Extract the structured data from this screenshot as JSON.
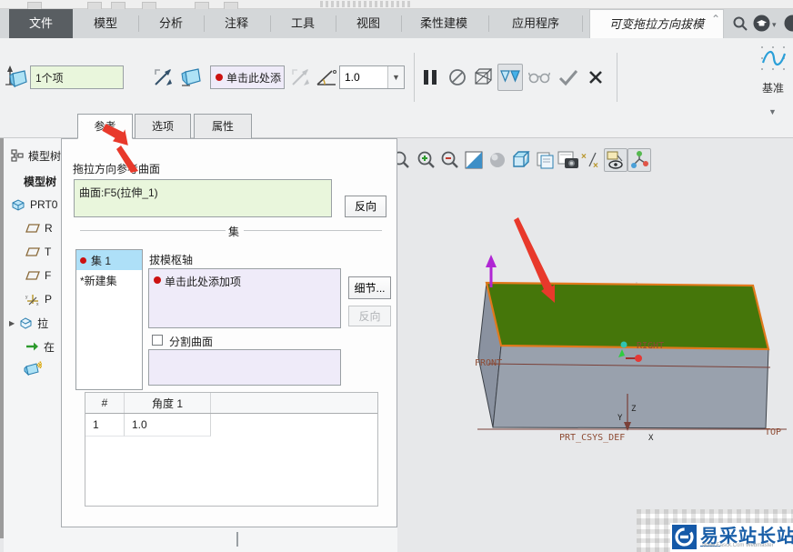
{
  "menu": {
    "tabs": [
      "文件",
      "模型",
      "分析",
      "注释",
      "工具",
      "视图",
      "柔性建模",
      "应用程序"
    ],
    "contextual_tab": "可变拖拉方向拔模"
  },
  "dashboard": {
    "surfaces_value": "1个项",
    "hinge_value": "单击此处添",
    "angle_value": "1.0",
    "datum_group_label": "基准"
  },
  "dialog": {
    "tabs": [
      "参考",
      "选项",
      "属性"
    ],
    "reference_label": "拖拉方向参考曲面",
    "reference_value": "曲面:F5(拉伸_1)",
    "flip_button": "反向",
    "sets_divider": "集",
    "set_items": [
      "集 1",
      "*新建集"
    ],
    "hinge_label": "拔模枢轴",
    "hinge_placeholder": "单击此处添加项",
    "details_button": "细节...",
    "flip2_button": "反向",
    "split_label": "分割曲面",
    "table": {
      "headers": [
        "#",
        "角度 1"
      ],
      "rows": [
        [
          "1",
          "1.0"
        ]
      ]
    }
  },
  "tree": {
    "panel_title": "模型树",
    "header": "模型树",
    "items": [
      "PRT0",
      "R",
      "T",
      "F",
      "P",
      "拉",
      "在",
      ""
    ]
  },
  "viewport": {
    "labels": {
      "front": "FRONT",
      "right": "RIGHT",
      "top": "TOP",
      "csys": "PRT_CSYS_DEF",
      "x": "X",
      "y": "Y",
      "z": "Z"
    }
  },
  "watermark": {
    "title": "易采站长站",
    "subtitle": "Www.Easck.Com Webmaster"
  },
  "colors": {
    "top_face": "#45760a",
    "face_highlight": "#e0791c",
    "box_front": "#99a1ad",
    "box_left": "#8a92a0",
    "annotation_red": "#e8392b",
    "drag_arrow": "#b026d4",
    "selection_field": "#e9f6dc",
    "collector_field": "#efebf9",
    "list_selection": "#aee0f8"
  }
}
